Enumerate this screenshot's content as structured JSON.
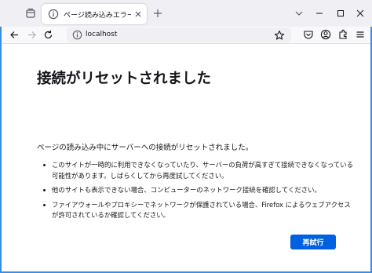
{
  "browser": {
    "tab": {
      "title": "ページ読み込みエラー"
    },
    "url": "localhost",
    "icons": {
      "tabs_menu": "tabs-menu-icon",
      "tab_favicon": "info-circle-icon",
      "tab_close": "close-icon",
      "new_tab": "plus-icon",
      "list_all_tabs": "chevron-down-icon",
      "back": "arrow-left-icon",
      "forward": "arrow-right-icon",
      "reload": "reload-icon",
      "site_info": "info-circle-icon",
      "bookmark": "star-icon",
      "pocket": "pocket-icon",
      "account": "account-icon",
      "extensions": "puzzle-icon",
      "menu": "hamburger-icon"
    }
  },
  "page": {
    "title": "接続がリセットされました",
    "description": "ページの読み込み中にサーバーへの接続がリセットされました。",
    "bullets": [
      "このサイトが一時的に利用できなくなっていたり、サーバーの負荷が高すぎて接続できなくなっている可能性があります。しばらくしてから再度試してください。",
      "他のサイトも表示できない場合、コンピューターのネットワーク接続を確認してください。",
      "ファイアウォールやプロキシーでネットワークが保護されている場合、Firefox によるウェブアクセスが許可されているか確認してください。"
    ],
    "retry_label": "再試行"
  },
  "colors": {
    "accent": "#0061e0",
    "frame": "#3a8ee6",
    "tabstrip_bg": "#f0f0f4",
    "text": "#15141a"
  }
}
